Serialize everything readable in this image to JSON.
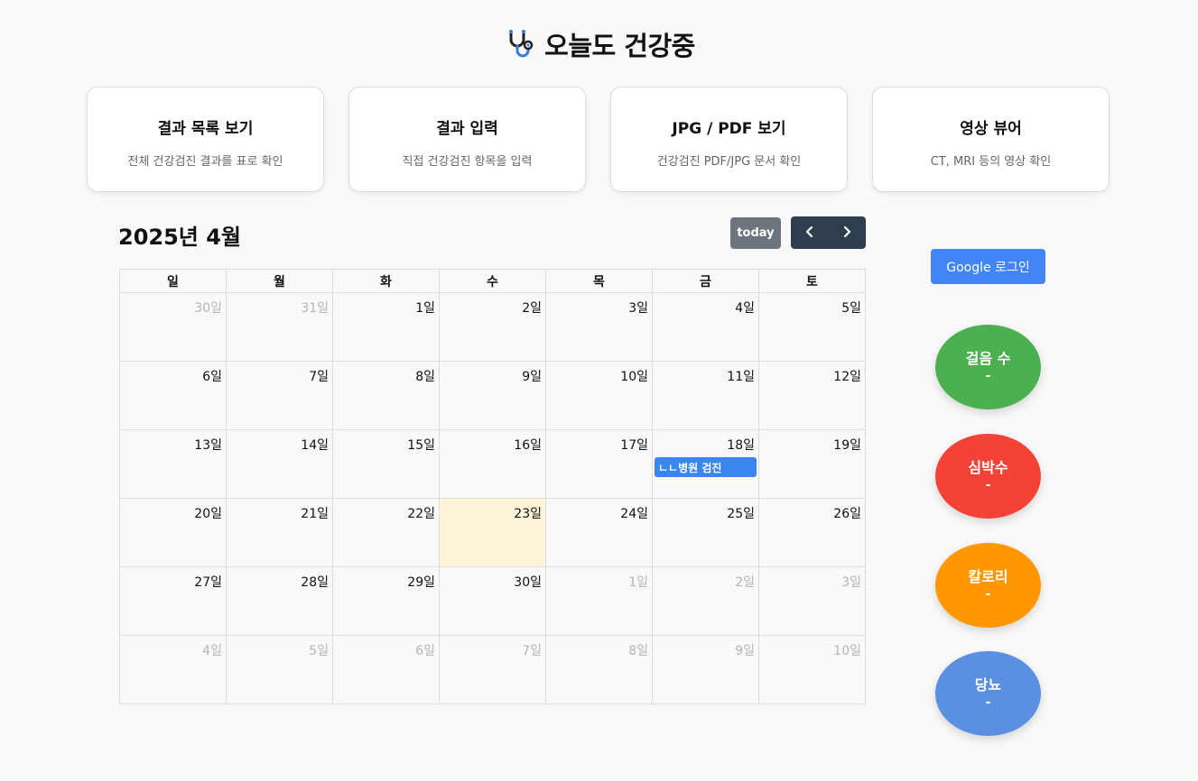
{
  "header": {
    "title": "오늘도 건강중",
    "logo_icon": "stethoscope-icon"
  },
  "menu_cards": [
    {
      "title": "결과 목록 보기",
      "desc": "전체 건강검진 결과를 표로 확인"
    },
    {
      "title": "결과 입력",
      "desc": "직접 건강검진 항목을 입력"
    },
    {
      "title": "JPG / PDF 보기",
      "desc": "건강검진 PDF/JPG 문서 확인"
    },
    {
      "title": "영상 뷰어",
      "desc": "CT, MRI 등의 영상 확인"
    }
  ],
  "calendar": {
    "title": "2025년 4월",
    "today_label": "today",
    "prev_icon": "chevron-left-icon",
    "next_icon": "chevron-right-icon",
    "weekdays": [
      "일",
      "월",
      "화",
      "수",
      "목",
      "금",
      "토"
    ],
    "weeks": [
      [
        {
          "label": "30일",
          "other": true
        },
        {
          "label": "31일",
          "other": true
        },
        {
          "label": "1일"
        },
        {
          "label": "2일"
        },
        {
          "label": "3일"
        },
        {
          "label": "4일"
        },
        {
          "label": "5일"
        }
      ],
      [
        {
          "label": "6일"
        },
        {
          "label": "7일"
        },
        {
          "label": "8일"
        },
        {
          "label": "9일"
        },
        {
          "label": "10일"
        },
        {
          "label": "11일"
        },
        {
          "label": "12일"
        }
      ],
      [
        {
          "label": "13일"
        },
        {
          "label": "14일"
        },
        {
          "label": "15일"
        },
        {
          "label": "16일"
        },
        {
          "label": "17일"
        },
        {
          "label": "18일",
          "event": "ㄴㄴ병원 검진"
        },
        {
          "label": "19일"
        }
      ],
      [
        {
          "label": "20일"
        },
        {
          "label": "21일"
        },
        {
          "label": "22일"
        },
        {
          "label": "23일",
          "today": true
        },
        {
          "label": "24일"
        },
        {
          "label": "25일"
        },
        {
          "label": "26일"
        }
      ],
      [
        {
          "label": "27일"
        },
        {
          "label": "28일"
        },
        {
          "label": "29일"
        },
        {
          "label": "30일"
        },
        {
          "label": "1일",
          "other": true
        },
        {
          "label": "2일",
          "other": true
        },
        {
          "label": "3일",
          "other": true
        }
      ],
      [
        {
          "label": "4일",
          "other": true
        },
        {
          "label": "5일",
          "other": true
        },
        {
          "label": "6일",
          "other": true
        },
        {
          "label": "7일",
          "other": true
        },
        {
          "label": "8일",
          "other": true
        },
        {
          "label": "9일",
          "other": true
        },
        {
          "label": "10일",
          "other": true
        }
      ]
    ]
  },
  "sidebar": {
    "google_login_label": "Google 로그인",
    "metrics": [
      {
        "name": "steps",
        "label": "걸음 수",
        "value": "-",
        "color": "#4caf50"
      },
      {
        "name": "heart-rate",
        "label": "심박수",
        "value": "-",
        "color": "#f44336"
      },
      {
        "name": "calories",
        "label": "칼로리",
        "value": "-",
        "color": "#ff9800"
      },
      {
        "name": "blood-sugar",
        "label": "당뇨",
        "value": "-",
        "color": "#5b8fe0"
      }
    ]
  },
  "colors": {
    "event": "#3a86f0",
    "today_cell": "#fcf3d9",
    "nav": "#2c3e50",
    "today_button": "#6c757d",
    "google": "#4285f4"
  }
}
